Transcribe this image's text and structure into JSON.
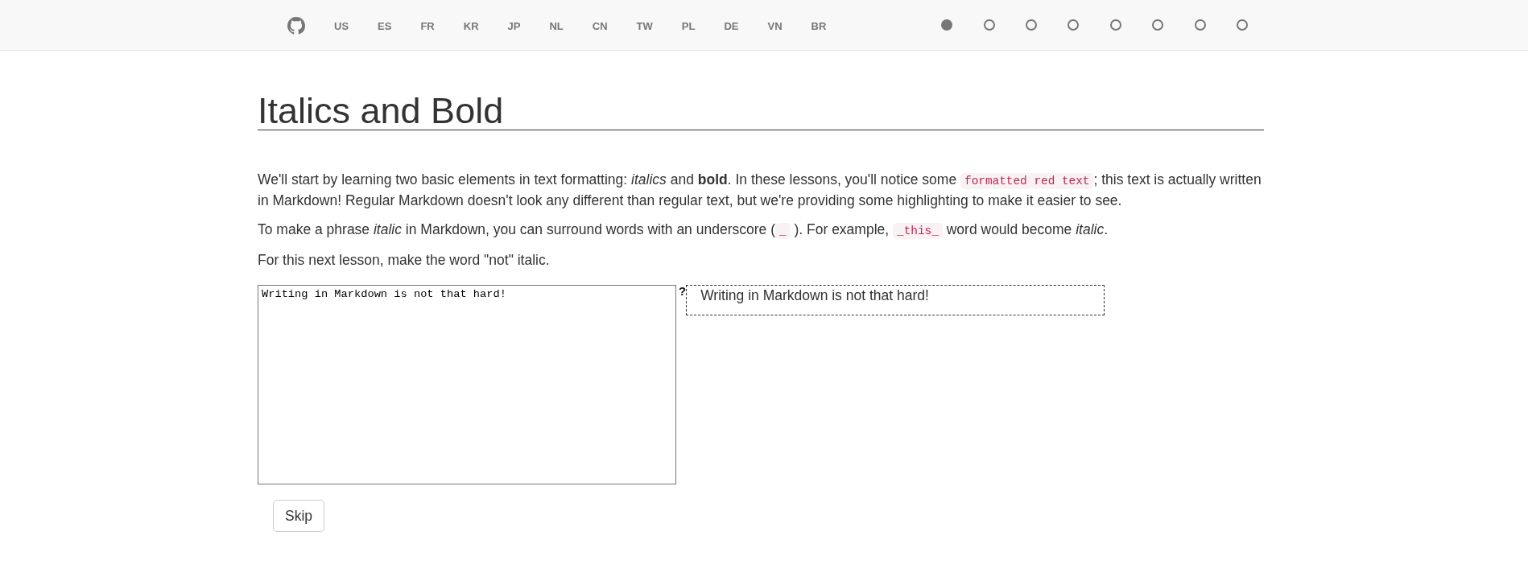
{
  "nav": {
    "languages": [
      "US",
      "ES",
      "FR",
      "KR",
      "JP",
      "NL",
      "CN",
      "TW",
      "PL",
      "DE",
      "VN",
      "BR"
    ]
  },
  "lesson_dots": [
    {
      "selected": true
    },
    {
      "selected": false
    },
    {
      "selected": false
    },
    {
      "selected": false
    },
    {
      "selected": false
    },
    {
      "selected": false
    },
    {
      "selected": false
    },
    {
      "selected": false
    }
  ],
  "lesson": {
    "title": "Italics and Bold",
    "paragraphs": [
      {
        "segments": [
          {
            "kind": "text",
            "text": "We'll start by learning two basic elements in text formatting: *italics* and **bold**. In these lessons, you'll notice some "
          },
          {
            "kind": "code",
            "text": "formatted red text"
          },
          {
            "kind": "text",
            "text": "; this text is actually written in Markdown! Regular Markdown doesn't look any different than regular text, but we're providing some highlighting to make it easier to see."
          }
        ]
      },
      {
        "segments": [
          {
            "kind": "text",
            "text": "To make a phrase *italic* in Markdown, you can surround words with an underscore ("
          },
          {
            "kind": "code",
            "text": "_"
          },
          {
            "kind": "text",
            "text": " ). For example, "
          },
          {
            "kind": "code",
            "text": "_this_"
          },
          {
            "kind": "text",
            "text": " word would become *italic*."
          }
        ]
      },
      {
        "segments": [
          {
            "kind": "text",
            "text": "For this next lesson, make the word \"not\" italic."
          }
        ]
      }
    ]
  },
  "editor": {
    "value": "Writing in Markdown is not that hard!",
    "help": "?"
  },
  "preview": {
    "text": "Writing in Markdown is not that hard!"
  },
  "skip_button": "Skip"
}
